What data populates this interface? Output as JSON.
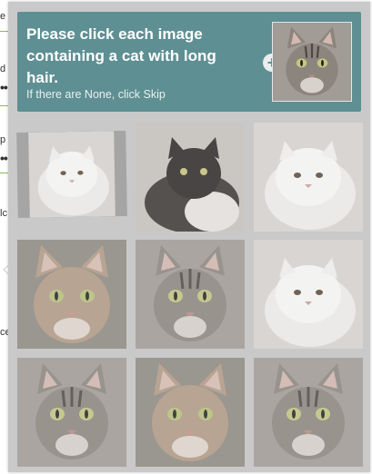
{
  "background_page": {
    "fragments": [
      "e",
      "d",
      "p",
      "lc",
      "ce"
    ],
    "dots": [
      "••",
      "••"
    ]
  },
  "challenge": {
    "prompt": "Please click each image containing a cat with long hair.",
    "subtext": "If there are None, click Skip",
    "add_button": "+",
    "sample_image": {
      "icon": "tabby-cat-image"
    },
    "tiles": [
      {
        "id": 1,
        "image": "white-persian-cat-image"
      },
      {
        "id": 2,
        "image": "black-white-longhair-cat-image"
      },
      {
        "id": 3,
        "image": "white-persian-cat-image"
      },
      {
        "id": 4,
        "image": "orange-tabby-cat-image"
      },
      {
        "id": 5,
        "image": "gray-tabby-cat-image"
      },
      {
        "id": 6,
        "image": "white-persian-cat-image"
      },
      {
        "id": 7,
        "image": "gray-tabby-cat-image"
      },
      {
        "id": 8,
        "image": "brown-tabby-cat-image"
      },
      {
        "id": 9,
        "image": "brown-tabby-cat-image"
      }
    ]
  },
  "colors": {
    "header": "#5e8f93",
    "panel": "#c9c9c9",
    "accent_line": "#8cbf3f"
  }
}
